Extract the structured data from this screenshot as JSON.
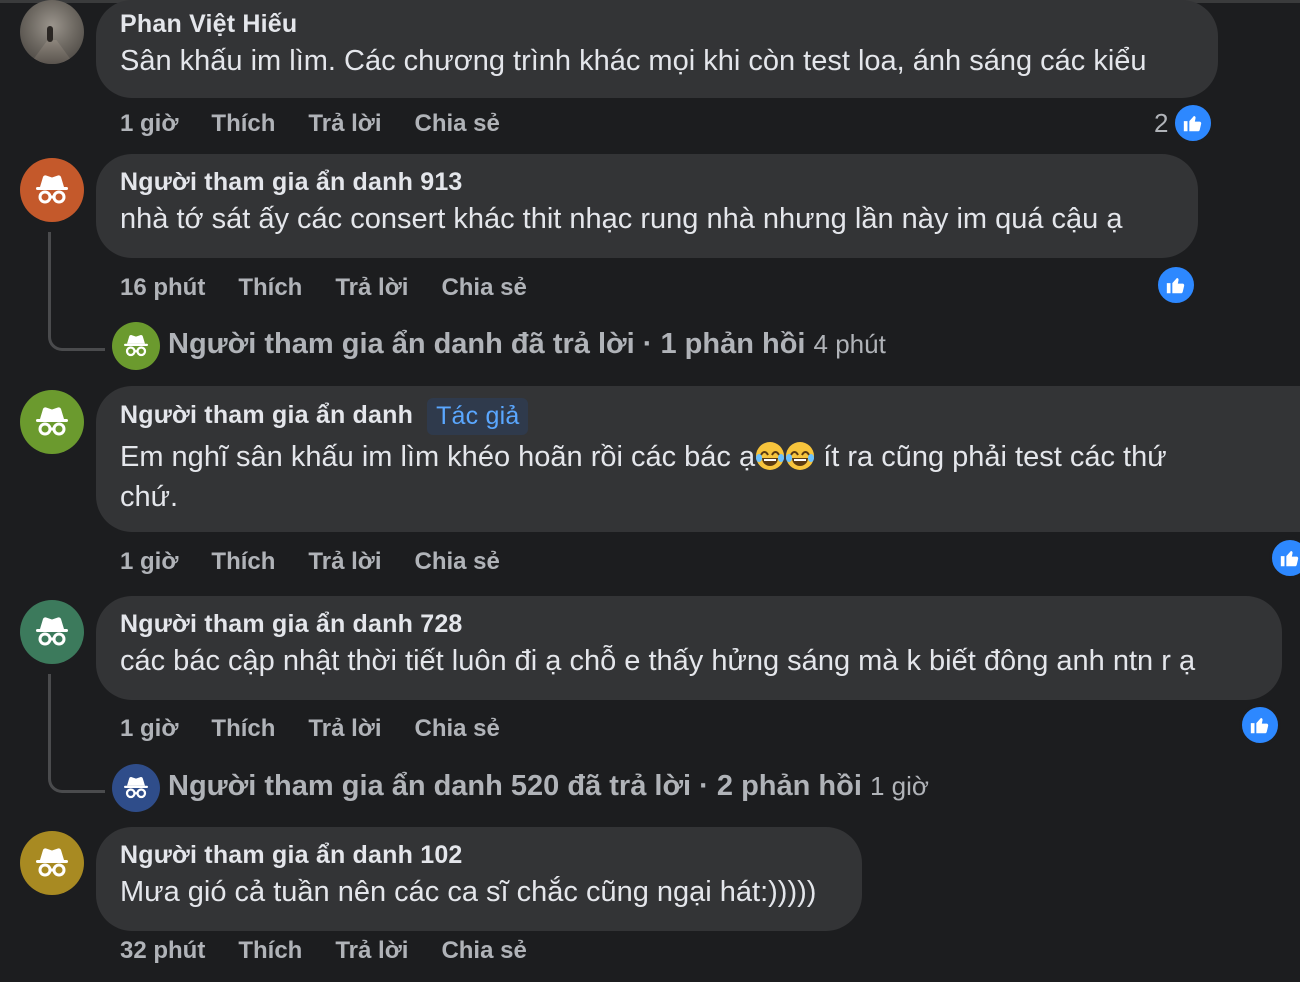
{
  "colors": {
    "background": "#1c1d1f",
    "bubble": "#333436",
    "like_blue": "#2d88ff",
    "author_badge_text": "#5aa7ff"
  },
  "comments": [
    {
      "name": "Phan Việt Hiếu",
      "text": "Sân khấu im lìm. Các chương trình khác mọi khi còn test loa, ánh sáng các kiểu",
      "time": "1 giờ",
      "like": "Thích",
      "reply": "Trả lời",
      "share": "Chia sẻ",
      "reaction_count": "2",
      "avatar": "photo"
    },
    {
      "name": "Người tham gia ẩn danh 913",
      "text": "nhà tớ sát ấy các consert khác thit nhạc rung nhà nhưng lần này im quá cậu ạ",
      "time": "16 phút",
      "like": "Thích",
      "reply": "Trả lời",
      "share": "Chia sẻ",
      "avatar": "incognito",
      "avatar_color": "#c4592b"
    },
    {
      "name": "Người tham gia ẩn danh",
      "badge": "Tác giả",
      "text_line1": "Em nghĩ sân khấu im lìm khéo hoãn rồi các bác ạ",
      "text_line1b": "ít ra cũng phải test các thứ",
      "text_line2": "chứ.",
      "time": "1 giờ",
      "like": "Thích",
      "reply": "Trả lời",
      "share": "Chia sẻ",
      "avatar": "incognito",
      "avatar_color": "#6b9a2e"
    },
    {
      "name": "Người tham gia ẩn danh 728",
      "text": "các bác cập nhật thời tiết luôn đi ạ chỗ e thấy hửng sáng mà k biết đông anh ntn r ạ",
      "time": "1 giờ",
      "like": "Thích",
      "reply": "Trả lời",
      "share": "Chia sẻ",
      "avatar": "incognito",
      "avatar_color": "#3c7a5c"
    },
    {
      "name": "Người tham gia ẩn danh 102",
      "text": "Mưa gió cả tuần nên các ca sĩ chắc cũng ngại hát:)))))",
      "time": "32 phút",
      "like": "Thích",
      "reply": "Trả lời",
      "share": "Chia sẻ",
      "avatar": "incognito",
      "avatar_color": "#a88a22"
    }
  ],
  "replies": [
    {
      "who": "Người tham gia ẩn danh đã trả lời",
      "sep": " · ",
      "count": "1 phản hồi",
      "ago": "4 phút",
      "avatar_color": "#6b9a2e"
    },
    {
      "who": "Người tham gia ẩn danh 520 đã trả lời",
      "sep": " · ",
      "count": "2 phản hồi",
      "ago": "1 giờ",
      "avatar_color": "#2f4d8a"
    }
  ],
  "icons": {
    "incognito": "incognito-icon",
    "like": "thumbs-up-icon",
    "laugh": "laughing-emoji-icon"
  }
}
